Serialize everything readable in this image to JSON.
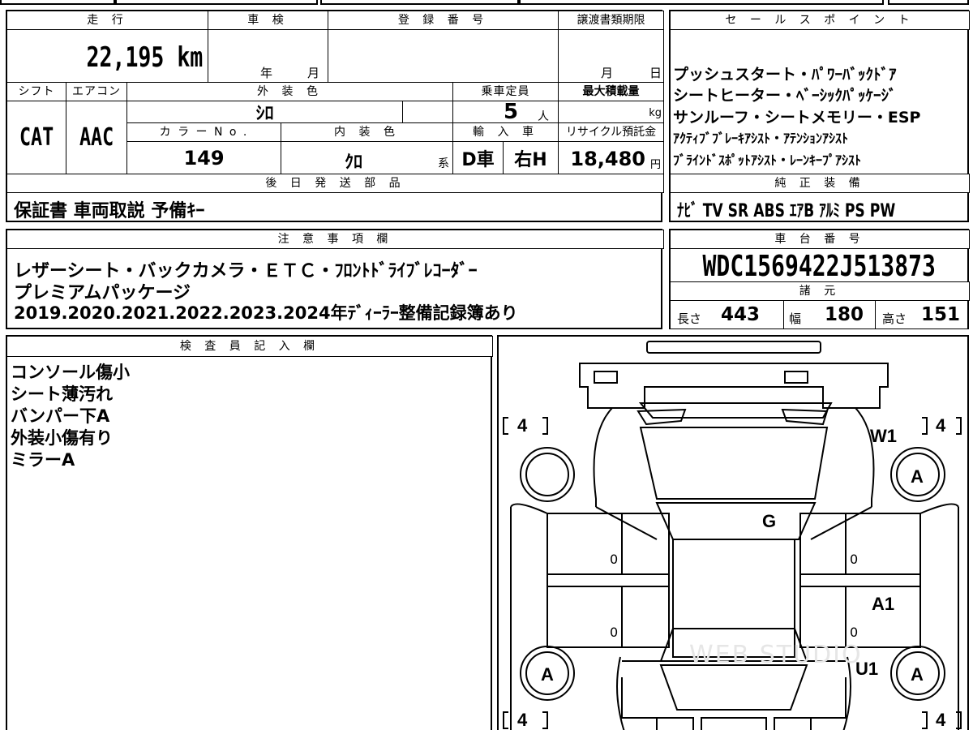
{
  "vehicle": {
    "mileage_header": "走 行",
    "mileage_value": "22,195",
    "mileage_unit": "km",
    "inspection_header": "車 検",
    "inspection_year": "年",
    "inspection_month": "月",
    "registration_header": "登 録 番 号",
    "transfer_header": "譲渡書類期限",
    "transfer_month": "月",
    "transfer_day": "日",
    "shift_header": "シフト",
    "shift_value": "CAT",
    "aircon_header": "エアコン",
    "aircon_value": "AAC",
    "exterior_color_header": "外 装 色",
    "exterior_color_value": "ｼﾛ",
    "capacity_header": "乗車定員",
    "capacity_value": "5",
    "capacity_unit": "人",
    "max_load_header": "最大積載量",
    "max_load_unit": "kg",
    "color_no_header": "カ ラ ー N o .",
    "color_no_value": "149",
    "interior_color_header": "内 装 色",
    "interior_color_value": "ｸﾛ",
    "interior_suffix": "系",
    "import_header": "輸 入 車",
    "import_value": "D車",
    "steering_value": "右H",
    "recycle_header": "リサイクル預託金",
    "recycle_value": "18,480",
    "recycle_unit": "円"
  },
  "sales_points": {
    "header": "セ ー ル ス ポ イ ン ト",
    "lines": [
      "プッシュスタート・ﾊﾟﾜｰﾊﾞｯｸﾄﾞｱ",
      "シートヒーター・ﾍﾞｰｼｯｸﾊﾟｯｹｰｼﾞ",
      "サンルーフ・シートメモリー・ESP",
      "ｱｸﾃｨﾌﾞﾌﾞﾚｰｷｱｼｽﾄ・ｱﾃﾝｼｮﾝｱｼｽﾄ",
      "ﾌﾞﾗｲﾝﾄﾞｽﾎﾟｯﾄｱｼｽﾄ・ﾚｰﾝｷｰﾌﾟｱｼｽﾄ"
    ]
  },
  "later_parts": {
    "header": "後 日 発 送 部 品",
    "value": "保証書 車両取説 予備ｷｰ"
  },
  "genuine_equipment": {
    "header": "純 正 装 備",
    "value": "ﾅﾋﾞ  TV  SR  ABS  ｴｱB  ｱﾙﾐ  PS  PW"
  },
  "notes": {
    "header": "注 意 事 項 欄",
    "lines": [
      "レザーシート・バックカメラ・ＥＴＣ・ﾌﾛﾝﾄﾄﾞﾗｲﾌﾞﾚｺｰﾀﾞｰ",
      "プレミアムパッケージ",
      "2019.2020.2021.2022.2023.2024年ﾃﾞｨｰﾗｰ整備記録簿あり"
    ]
  },
  "chassis": {
    "header": "車 台 番 号",
    "value": "WDC1569422J513873",
    "spec_header": "諸 元",
    "length_label": "長さ",
    "length_value": "443",
    "width_label": "幅",
    "width_value": "180",
    "height_label": "高さ",
    "height_value": "151"
  },
  "inspector": {
    "header": "検 査 員 記 入 欄",
    "lines": [
      "コンソール傷小",
      "シート薄汚れ",
      "バンパー下A",
      "外装小傷有り",
      "ミラーA"
    ]
  },
  "diagram": {
    "tread_fl": "4",
    "tread_fr": "4",
    "tread_rl": "4",
    "tread_rr": "4",
    "mark_w1": "W1",
    "mark_a_fr": "A",
    "mark_g": "G",
    "mark_a1": "A1",
    "mark_u1": "U1",
    "mark_a_rl": "A",
    "mark_a_rr": "A",
    "door_fl": "0",
    "door_rl": "0",
    "door_fr": "0",
    "door_rr": "0",
    "watermark": "WEB STUDIO"
  }
}
